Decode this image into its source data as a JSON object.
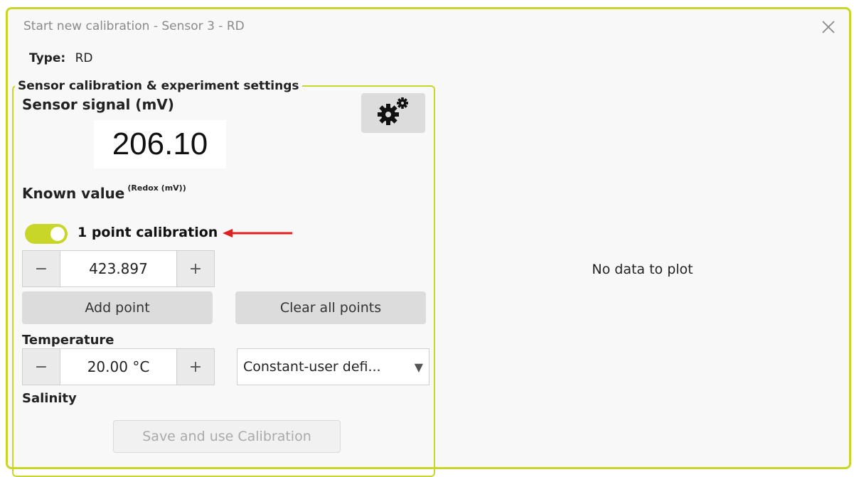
{
  "dialog": {
    "title": "Start new calibration - Sensor 3 - RD",
    "close_icon": "close-icon"
  },
  "type": {
    "label": "Type:",
    "value": "RD"
  },
  "settings": {
    "legend": "Sensor calibration & experiment settings",
    "signal_label": "Sensor signal (mV)",
    "signal_value": "206.10",
    "gear_icon": "gears-icon",
    "known_label": "Known value",
    "known_unit": "(Redox (mV))",
    "toggle": {
      "on": true,
      "label": "1 point calibration",
      "color": "#c8d62a"
    },
    "known_stepper": {
      "minus": "−",
      "value": "423.897",
      "plus": "+"
    },
    "add_point": "Add point",
    "clear_points": "Clear all points",
    "temperature_label": "Temperature",
    "temp_stepper": {
      "minus": "−",
      "value": "20.00 °C",
      "plus": "+"
    },
    "temp_mode": {
      "selected": "Constant-user defi...",
      "caret": "▼"
    },
    "salinity_label": "Salinity",
    "save_button": "Save and use Calibration"
  },
  "plot": {
    "empty_message": "No data to plot"
  },
  "colors": {
    "accent": "#c8d62a",
    "annotation_arrow": "#e02020"
  }
}
